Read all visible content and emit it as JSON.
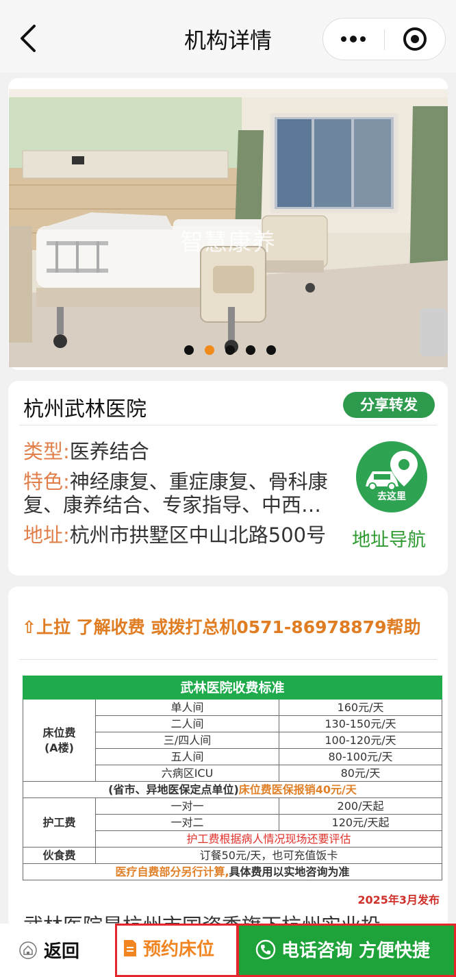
{
  "nav": {
    "title": "机构详情"
  },
  "gallery": {
    "watermark": "智慧康养",
    "slide_count": 5,
    "active_index": 1
  },
  "info": {
    "name": "杭州武林医院",
    "share_label": "分享转发",
    "type_label": "类型:",
    "type_value": "医养结合",
    "feature_label": "特色:",
    "feature_value": "神经康复、重症康复、骨科康复、康养结合、专家指导、中西…",
    "address_label": "地址:",
    "address_value": "杭州市拱墅区中山北路500号",
    "nav_link": "地址导航",
    "goto_label": "去这里"
  },
  "fees": {
    "pull_tip": "⇧上拉 了解收费 或拨打总机0571-86978879帮助",
    "table_title": "武林医院收费标准",
    "bed_category": "床位费",
    "bed_sub": "(A楼)",
    "bed_rows": [
      {
        "item": "单人间",
        "price": "160元/天"
      },
      {
        "item": "二人间",
        "price": "130-150元/天"
      },
      {
        "item": "三/四人间",
        "price": "100-120元/天"
      },
      {
        "item": "五人间",
        "price": "80-100元/天"
      },
      {
        "item": "六病区ICU",
        "price": "80元/天"
      }
    ],
    "insurance_note_a": "(省市、异地医保定点单位)",
    "insurance_note_b": "床位费医保报销40元/天",
    "care_category": "护工费",
    "care_rows": [
      {
        "item": "一对一",
        "price": "200/天起"
      },
      {
        "item": "一对二",
        "price": "120元/天起"
      }
    ],
    "care_note": "护工费根据病人情况现场还要评估",
    "meal_category": "伙食费",
    "meal_value": "订餐50元/天，也可充值饭卡",
    "footer_note_a": "医疗自费部分另行计算,",
    "footer_note_b": "具体费用以实地咨询为准",
    "publish_date": "2025年3月发布",
    "intro_text": "武林医院是杭州市国资委旗下杭州实业投"
  },
  "bottom": {
    "back_label": "返回",
    "book_label": "预约床位",
    "call_label": "电话咨询 方便快捷"
  },
  "colors": {
    "accent_green": "#2e9a4e",
    "label_orange": "#e07f4a",
    "warning_red": "#e0302a",
    "call_green": "#1ea33a"
  }
}
